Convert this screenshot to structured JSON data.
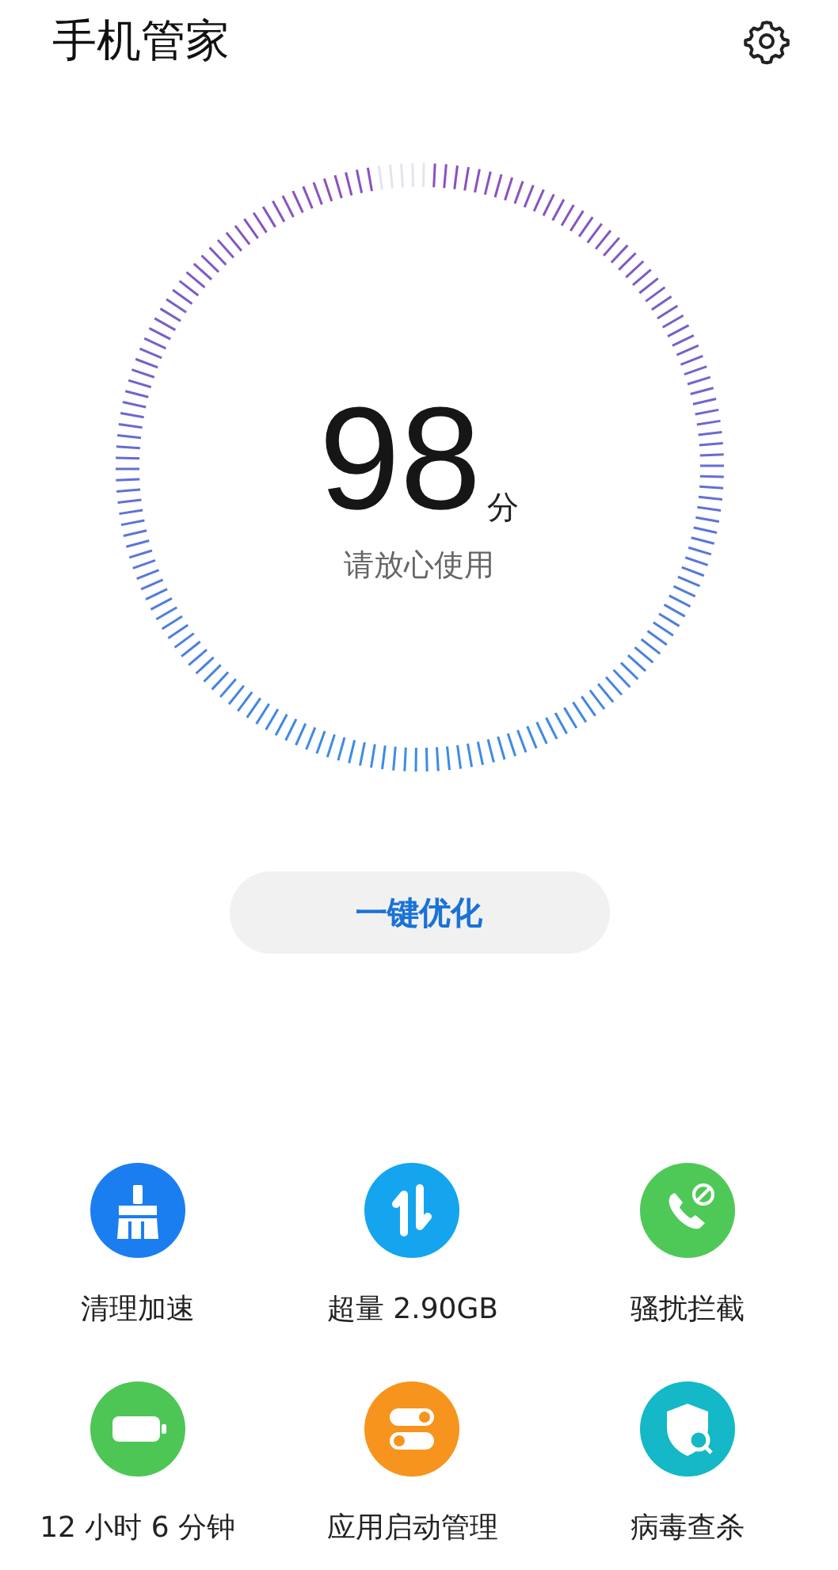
{
  "header": {
    "title": "手机管家"
  },
  "score": {
    "value": "98",
    "unit": "分",
    "status": "请放心使用"
  },
  "optimize_button": {
    "label": "一键优化"
  },
  "tools": [
    {
      "kind": "broom",
      "label": "清理加速",
      "color": "#1b7ef0"
    },
    {
      "kind": "data",
      "label": "超量 2.90GB",
      "color": "#14a5ee"
    },
    {
      "kind": "call-block",
      "label": "骚扰拦截",
      "color": "#4ec957"
    },
    {
      "kind": "battery",
      "label": "12 小时 6 分钟",
      "color": "#4dc656"
    },
    {
      "kind": "toggles",
      "label": "应用启动管理",
      "color": "#f7941d"
    },
    {
      "kind": "shield",
      "label": "病毒查杀",
      "color": "#14b8c6"
    }
  ]
}
